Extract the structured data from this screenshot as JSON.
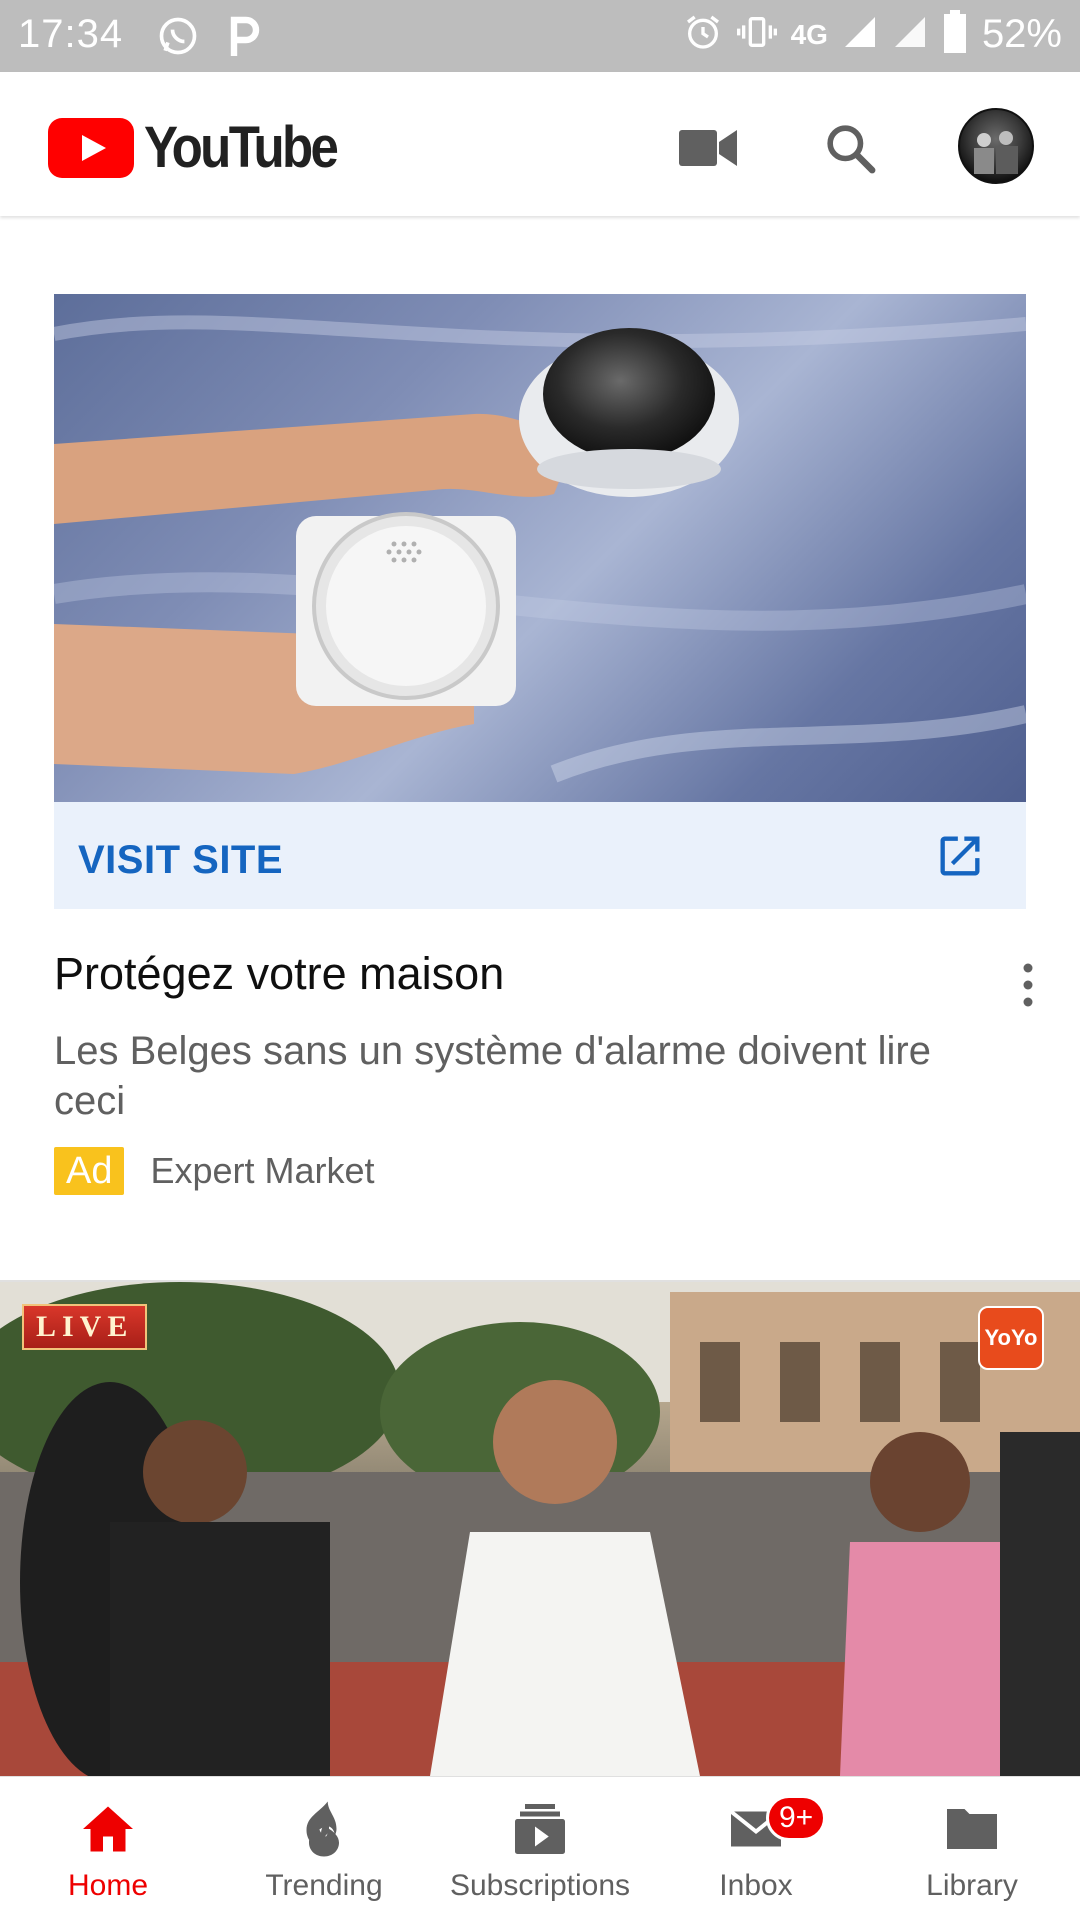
{
  "status_bar": {
    "time": "17:34",
    "network": "4G",
    "battery": "52%"
  },
  "app_bar": {
    "brand": "YouTube"
  },
  "ad": {
    "cta_label": "VISIT SITE",
    "title": "Protégez votre maison",
    "description": "Les Belges sans un système d'alarme doivent lire ceci",
    "badge": "Ad",
    "advertiser": "Expert Market"
  },
  "video": {
    "live_tag": "LIVE",
    "channel_logo": "YoYo"
  },
  "bottom_nav": {
    "items": [
      {
        "label": "Home",
        "icon": "home-icon",
        "active": true
      },
      {
        "label": "Trending",
        "icon": "flame-icon"
      },
      {
        "label": "Subscriptions",
        "icon": "subscriptions-icon"
      },
      {
        "label": "Inbox",
        "icon": "mail-icon",
        "badge": "9+"
      },
      {
        "label": "Library",
        "icon": "folder-icon"
      }
    ]
  },
  "colors": {
    "brand_red": "#ff0000",
    "active_nav": "#ee0000",
    "cta_blue": "#1565c0",
    "ad_badge": "#f9c21d"
  }
}
